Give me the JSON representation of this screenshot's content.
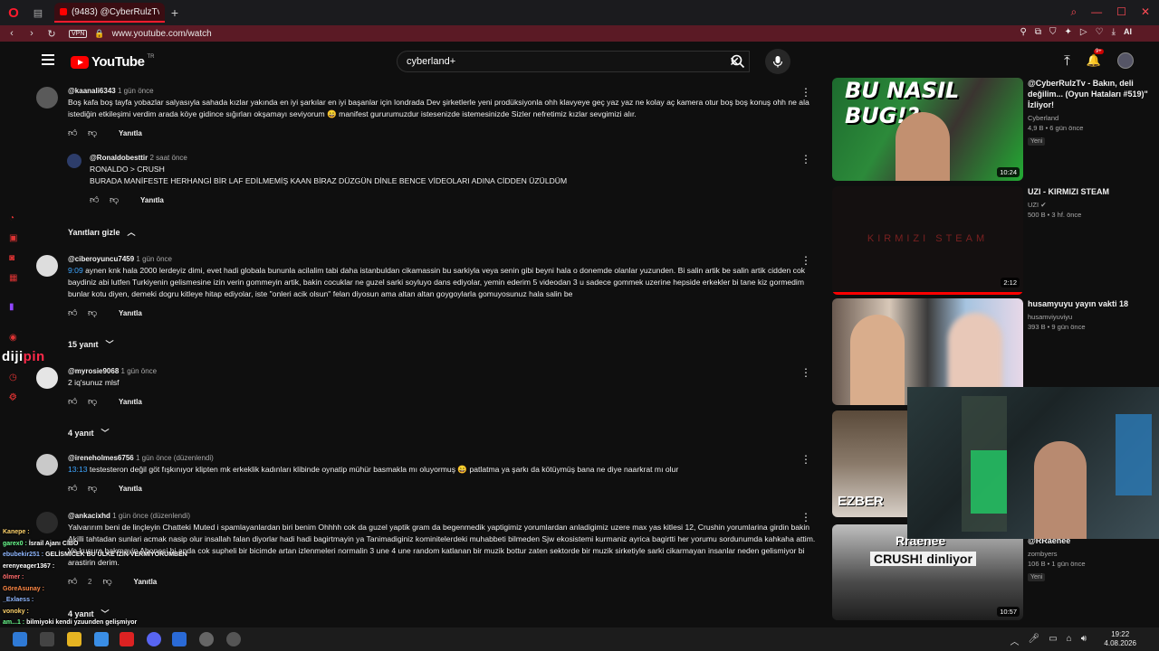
{
  "browser": {
    "tab_title": "(9483) @CyberRulzTv - YE",
    "new_tab": "+",
    "vpn": "VPN",
    "url": "www.youtube.com/watch",
    "ai_label": "AI"
  },
  "header": {
    "logo_text": "YouTube",
    "logo_region": "TR",
    "search_value": "cyberland+",
    "notif_badge": "9+"
  },
  "comments": [
    {
      "user": "@kaanali6343",
      "time": "1 gün önce",
      "text": "Boş kafa boş tayfa yobazlar salyasıyla sahada kızlar yakında en iyi şarkılar en iyi başanlar için londrada Dev şirketlerle yeni prodüksiyonla ohh klavyeye geç yaz yaz ne kolay aç kamera otur boş boş konuş ohh ne ala istediğin etkileşimi verdim arada köye gidince sığırları okşamayı seviyorum 😄 manifest gururumuzdur istesenizde istemesinizde Sizler nefretimiz kızlar sevgimizi alır.",
      "reply": "Yanıtla"
    },
    {
      "user": "@Ronaldobesttir",
      "time": "2 saat önce",
      "text1": "RONALDO > CRUSH",
      "text2": "BURADA MANİFESTE HERHANGİ BİR LAF EDİLMEMİŞ KAAN BİRAZ DÜZGÜN DİNLE BENCE VİDEOLARI ADINA CİDDEN ÜZÜLDÜM",
      "reply": "Yanıtla"
    },
    {
      "user": "@ciberoyuncu7459",
      "time": "1 gün önce",
      "timestamp": "9:09",
      "text": " aynen knk hala 2000 lerdeyiz dimi, evet hadi globala bununla acilalim tabi daha istanbuldan cikamassin bu sarkiyla veya senin gibi beyni hala o donemde olanlar yuzunden. Bi salin artik be salin artik cidden cok baydiniz abi lutfen Turkiyenin gelismesine izin verin gommeyin artik, bakin cocuklar ne guzel sarki soyluyo dans ediyolar, yemin ederim 5 videodan 3 u sadece gommek uzerine hepside erkekler bi tane kiz gormedim bunlar kotu diyen, demeki dogru kitleye hitap ediyolar, iste \"onleri acik olsun\" felan diyosun ama altan altan goygoylarla gomuyosunuz hala salin be",
      "reply": "Yanıtla"
    },
    {
      "user": "@myrosie9068",
      "time": "1 gün önce",
      "text": "2 iq'sunuz mlsf",
      "reply": "Yanıtla"
    },
    {
      "user": "@ireneholmes6756",
      "time": "1 gün önce (düzenlendi)",
      "timestamp": "13:13",
      "text": " testesteron değil göt fışkınıyor klipten mk erkeklik kadınları klibinde oynatip mühür basmakla mı oluyormuş 😄 patlatma ya şarkı da kötüymüş bana ne diye naarkrat mı olur",
      "reply": "Yanıtla"
    },
    {
      "user": "@ankacixhd",
      "time": "1 gün önce (düzenlendi)",
      "text": "Yalvarırım beni de linçleyin Chatteki Muted i spamlayanlardan biri benim Ohhhh cok da guzel yaptik gram da begenmedik yaptigimiz yorumlardan anladigimiz uzere max yas kitlesi 12, Crushin yorumlarina girdin bakin Akilli tahtadan sunlari acmak nasip olur insallah falan diyorlar hadi hadi bagirtmayin ya Tanimadiginiz kominitelerdeki muhabbeti bilmeden Sjw ekosistemi kurmaniz ayrica bagirtti her yorumu sordunumda kahkaha attim. Ve kusura bakmayin Abonesi bi anda cok supheli bir bicimde artan izlenmeleri normalin 3 une 4 une random katlanan bir muzik bottur zaten sektorde bir muzik sirketiyle sarki cikarmayan insanlar neden gelismiyor bi arastirin derim.",
      "likes": "2",
      "reply": "Yanıtla"
    }
  ],
  "toggles": {
    "hide_replies": "Yanıtları gizle",
    "replies_15": "15 yanıt",
    "replies_4a": "4 yanıt",
    "replies_4b": "4 yanıt"
  },
  "related": [
    {
      "thumb_text": "BU NASIL BUG!?",
      "duration": "10:24",
      "title": "@CyberRulzTv - Bakın, deli değilim... (Oyun Hataları #519)\" İzliyor!",
      "channel": "Cyberland",
      "meta": "4,9 B • 6 gün önce",
      "badge": "Yeni"
    },
    {
      "thumb_text": "KIRMIZI STEAM",
      "duration": "2:12",
      "progress": 1.0,
      "title": "UZI - KIRMIZI STEAM",
      "channel": "UZI",
      "meta": "500 B • 3 hf. önce"
    },
    {
      "title": "husamyuyu yayın vakti 18",
      "channel": "husamviyuviyu",
      "meta": "393 B • 9 gün önce"
    },
    {
      "thumb_text": "EZBER"
    },
    {
      "thumb_text1": "Rraenee",
      "thumb_text2": "CRUSH! dinliyor",
      "duration": "10:57",
      "title": "dinliyor @wearecrushboys @RRaenee",
      "channel": "zombyers",
      "meta": "106 B • 1 gün önce",
      "badge": "Yeni"
    }
  ],
  "chat": [
    {
      "user": "Kanepe :",
      "msg": ""
    },
    {
      "user": "garex0 :",
      "msg": "İsrail Ajanı CİBO"
    },
    {
      "user": "ebubekir251 :",
      "msg": "GELİSMİCEK BU ÜLKE İZİN VERMİYORUMBEN"
    },
    {
      "user": "erenyeager1367 :",
      "msg": ""
    },
    {
      "user": "ölmer :",
      "msg": ""
    },
    {
      "user": "GöreAsunay :",
      "msg": ""
    },
    {
      "user": "_Exlaess :",
      "msg": ""
    },
    {
      "user": "vonoky :",
      "msg": ""
    },
    {
      "user": "am...1 :",
      "msg": "bilmiyoki kendi yzuunden gelişmiyor"
    }
  ],
  "watermark": {
    "a": "diji",
    "b": "pin"
  },
  "taskbar": {
    "time": "19:22",
    "date": "4.08.2026"
  }
}
